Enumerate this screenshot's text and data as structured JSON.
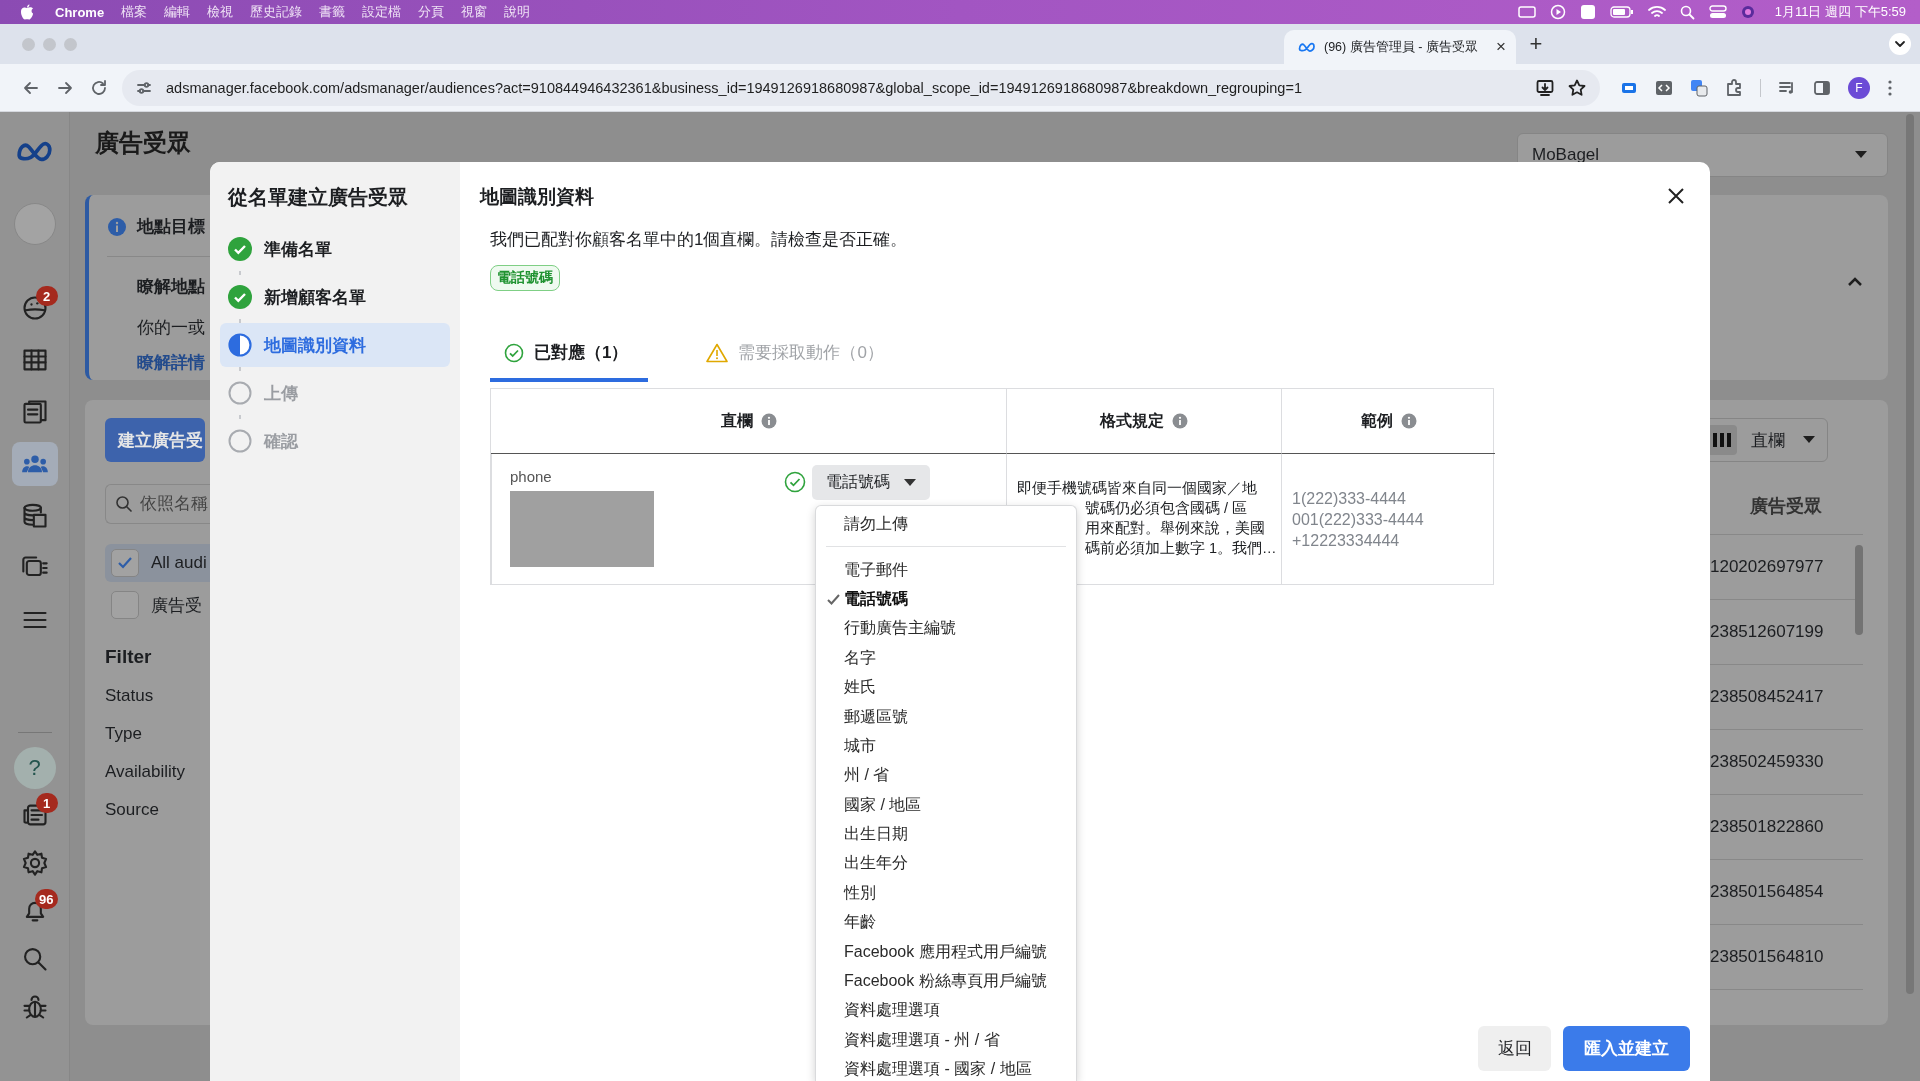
{
  "menu_bar": {
    "app": "Chrome",
    "items": [
      "檔案",
      "編輯",
      "檢視",
      "歷史記錄",
      "書籤",
      "設定檔",
      "分頁",
      "視窗",
      "說明"
    ],
    "clock": "1月11日 週四 下午5:59"
  },
  "browser": {
    "tab_title": "(96) 廣告管理員 - 廣告受眾",
    "tab_close": "×",
    "new_tab": "+",
    "url": "adsmanager.facebook.com/adsmanager/audiences?act=910844946432361&business_id=1949126918680987&global_scope_id=1949126918680987&breakdown_regrouping=1",
    "profile": "F"
  },
  "nav_rail": {
    "items": [
      {
        "kind": "palette",
        "badge": "2",
        "selected": false
      },
      {
        "kind": "table",
        "selected": false
      },
      {
        "kind": "pages",
        "selected": false
      },
      {
        "kind": "people",
        "selected": true
      },
      {
        "kind": "coins",
        "selected": false
      },
      {
        "kind": "cards",
        "selected": false
      },
      {
        "kind": "menu",
        "selected": false
      }
    ],
    "tools": [
      {
        "kind": "help",
        "glyph": "?"
      },
      {
        "kind": "news",
        "badge": "1"
      },
      {
        "kind": "settings"
      },
      {
        "kind": "bell",
        "badge": "96"
      },
      {
        "kind": "search"
      },
      {
        "kind": "bug"
      }
    ]
  },
  "page": {
    "title": "廣告受眾",
    "account": "MoBagel",
    "info_card": {
      "title": "地點目標",
      "line_1": "瞭解地點",
      "line_2": "你的一或",
      "link": "瞭解詳情"
    },
    "create_button": "建立廣告受",
    "search_placeholder": "依照名稱",
    "audience_filters": [
      {
        "label": "All audi",
        "checked": true
      },
      {
        "label": "廣告受",
        "checked": false
      }
    ],
    "filter_title": "Filter",
    "filter_items": [
      "Status",
      "Type",
      "Availability",
      "Source"
    ],
    "columns_button": "直欄",
    "column_heading": "廣告受眾",
    "ids": [
      "120202697977",
      "238512607199",
      "238508452417",
      "238502459330",
      "238501822860",
      "238501564854",
      "238501564810"
    ]
  },
  "modal": {
    "title": "從名單建立廣告受眾",
    "steps": [
      {
        "label": "準備名單",
        "completed": true,
        "selected": false
      },
      {
        "label": "新增顧客名單",
        "completed": true,
        "selected": false
      },
      {
        "label": "地圖識別資料",
        "completed": false,
        "selected": true
      },
      {
        "label": "上傳",
        "completed": false,
        "selected": false
      },
      {
        "label": "確認",
        "completed": false,
        "selected": false
      }
    ],
    "panel_title": "地圖識別資料",
    "intro": "我們已配對你顧客名單中的1個直欄。請檢查是否正確。",
    "tag": "電話號碼",
    "tabs": [
      {
        "label": "已對應（1）",
        "kind": "matched",
        "selected": true
      },
      {
        "label": "需要採取動作（0）",
        "kind": "warning",
        "selected": false
      }
    ],
    "table": {
      "columns": [
        "直欄",
        "格式規定",
        "範例"
      ],
      "rows": [
        {
          "source_column": "phone",
          "mapped": true,
          "mapping": "電話號碼",
          "format_lines": [
            "即便手機號碼皆來自同一個國家／地",
            "號碼仍必須包含國碼 / 區",
            "用來配對。舉例來說，美國",
            "碼前必須加上數字 1。我們…"
          ],
          "examples": [
            "1(222)333-4444",
            "001(222)333-4444",
            "+12223334444"
          ]
        }
      ]
    },
    "dropdown": {
      "sections": [
        {
          "items": [
            {
              "label": "請勿上傳",
              "checked": false
            }
          ]
        },
        {
          "items": [
            {
              "label": "電子郵件",
              "checked": false
            },
            {
              "label": "電話號碼",
              "checked": true
            },
            {
              "label": "行動廣告主編號",
              "checked": false
            },
            {
              "label": "名字",
              "checked": false
            },
            {
              "label": "姓氏",
              "checked": false
            },
            {
              "label": "郵遞區號",
              "checked": false
            },
            {
              "label": "城市",
              "checked": false
            },
            {
              "label": "州 / 省",
              "checked": false
            },
            {
              "label": "國家 / 地區",
              "checked": false
            },
            {
              "label": "出生日期",
              "checked": false
            },
            {
              "label": "出生年分",
              "checked": false
            },
            {
              "label": "性別",
              "checked": false
            },
            {
              "label": "年齡",
              "checked": false
            },
            {
              "label": "Facebook 應用程式用戶編號",
              "checked": false
            },
            {
              "label": "Facebook 粉絲專頁用戶編號",
              "checked": false
            },
            {
              "label": "資料處理選項",
              "checked": false
            },
            {
              "label": "資料處理選項 - 州 / 省",
              "checked": false
            },
            {
              "label": "資料處理選項 - 國家 / 地區",
              "checked": false
            }
          ]
        }
      ]
    },
    "buttons": [
      {
        "label": "返回",
        "kind": "secondary"
      },
      {
        "label": "匯入並建立",
        "kind": "primary"
      }
    ]
  }
}
